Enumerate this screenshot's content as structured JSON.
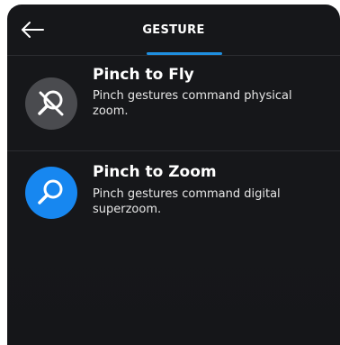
{
  "header": {
    "title": "GESTURE",
    "back_icon": "back-arrow-icon",
    "accent_color": "#1f8fe0"
  },
  "options": [
    {
      "title": "Pinch to Fly",
      "description": "Pinch gestures command physical zoom.",
      "icon": "zoom-off-icon",
      "icon_bg": "#4a4b4f",
      "selected": false
    },
    {
      "title": "Pinch to Zoom",
      "description": "Pinch gestures command digital superzoom.",
      "icon": "zoom-icon",
      "icon_bg": "#1787f0",
      "selected": true
    }
  ]
}
